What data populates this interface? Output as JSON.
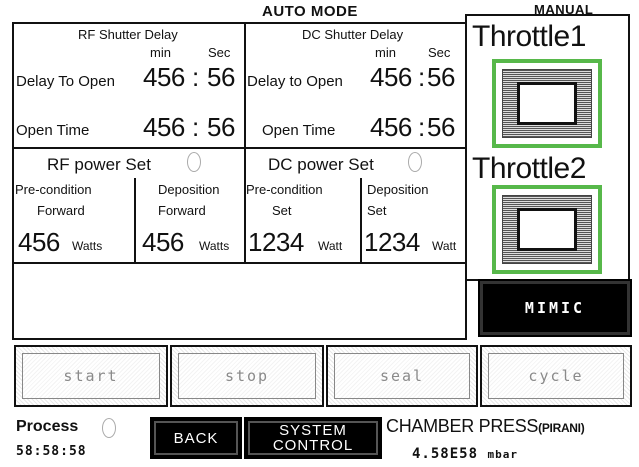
{
  "header": {
    "title": "AUTO MODE",
    "manual": "MANUAL"
  },
  "rf_shutter": {
    "title": "RF Shutter Delay",
    "min": "min",
    "sec": "Sec",
    "delay_label": "Delay To Open",
    "delay_min": "456",
    "delay_sec": "56",
    "open_label": "Open Time",
    "open_min": "456",
    "open_sec": "56",
    "sep": ":"
  },
  "dc_shutter": {
    "title": "DC Shutter Delay",
    "min": "min",
    "sec": "Sec",
    "delay_label": "Delay to Open",
    "delay_min": "456",
    "delay_sec": "56",
    "open_label": "Open Time",
    "open_min": "456",
    "open_sec": "56",
    "sep": ":"
  },
  "rf_power": {
    "title": "RF power Set",
    "pre_label": "Pre-condition",
    "pre_sub": "Forward",
    "pre_value": "456",
    "pre_unit": "Watts",
    "dep_label": "Deposition",
    "dep_sub": "Forward",
    "dep_value": "456",
    "dep_unit": "Watts"
  },
  "dc_power": {
    "title": "DC power Set",
    "pre_label": "Pre-condition",
    "pre_sub": "Set",
    "pre_value": "1234",
    "pre_unit": "Watt",
    "dep_label": "Deposition",
    "dep_sub": "Set",
    "dep_value": "1234",
    "dep_unit": "Watt"
  },
  "throttle": {
    "t1": "Throttle1",
    "t2": "Throttle2"
  },
  "mimic": "MIMIC",
  "actions": {
    "start": "start",
    "stop": "stop",
    "seal": "seal",
    "cycle": "cycle"
  },
  "footer": {
    "process": "Process",
    "timer": "58:58:58",
    "back": "BACK",
    "system": "SYSTEM",
    "control": "CONTROL",
    "chamber": "CHAMBER  PRESS",
    "pirani": "(PIRANI)",
    "pressure": "4.58E58",
    "pressure_unit": "mbar"
  },
  "colors": {
    "throttle_border": "#57b84a",
    "button_bg": "#000000"
  }
}
